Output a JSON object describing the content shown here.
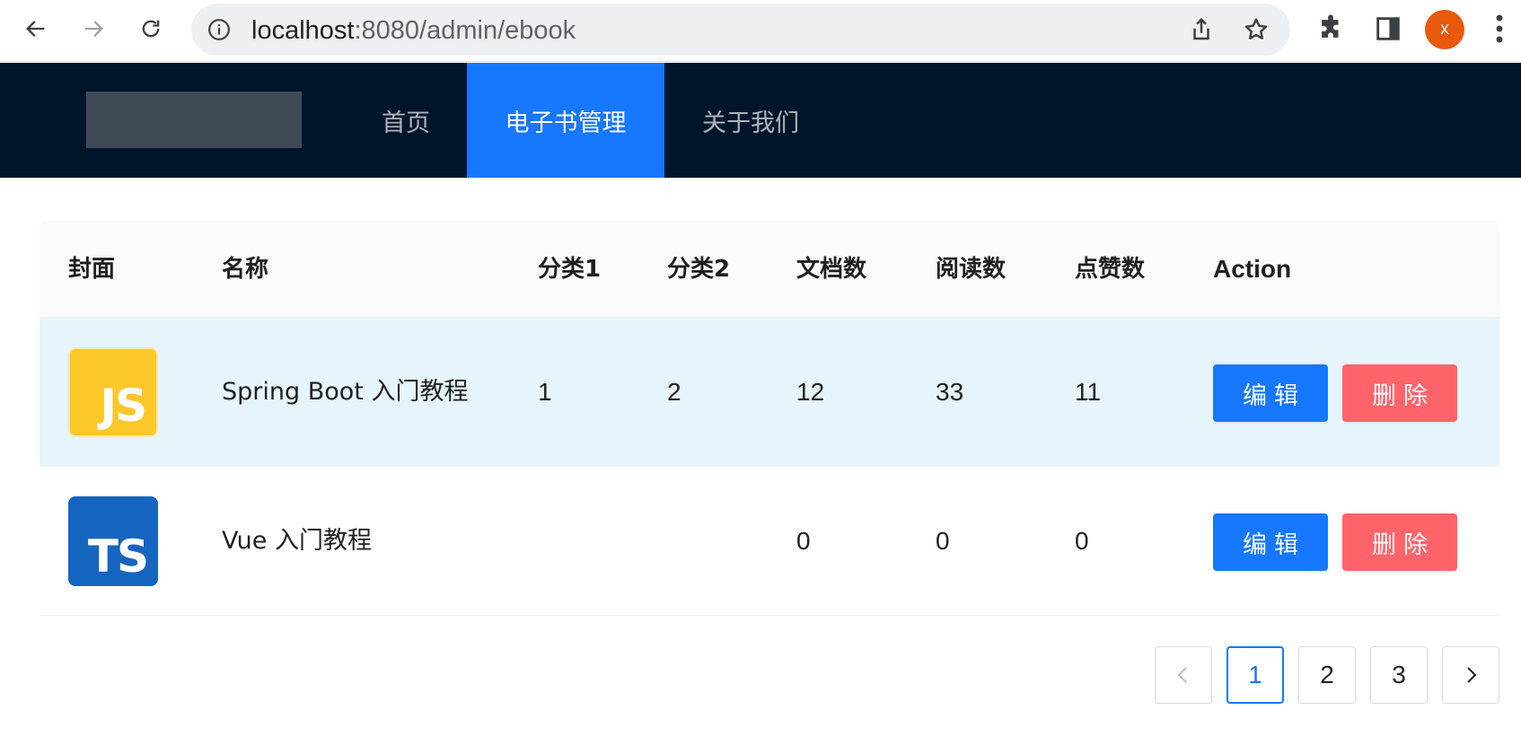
{
  "browser": {
    "url_host": "localhost",
    "url_path": ":8080/admin/ebook",
    "profile_initial": "x"
  },
  "header": {
    "menu": [
      {
        "label": "首页",
        "active": false
      },
      {
        "label": "电子书管理",
        "active": true
      },
      {
        "label": "关于我们",
        "active": false
      }
    ]
  },
  "table": {
    "columns": [
      "封面",
      "名称",
      "分类1",
      "分类2",
      "文档数",
      "阅读数",
      "点赞数",
      "Action"
    ],
    "rows": [
      {
        "cover": "JS",
        "name": "Spring Boot 入门教程",
        "category1": "1",
        "category2": "2",
        "docs": "12",
        "views": "33",
        "likes": "11"
      },
      {
        "cover": "TS",
        "name": "Vue 入门教程",
        "category1": "",
        "category2": "",
        "docs": "0",
        "views": "0",
        "likes": "0"
      }
    ],
    "edit_label": "编辑",
    "delete_label": "删除"
  },
  "pagination": {
    "pages": [
      "1",
      "2",
      "3"
    ],
    "current": "1"
  },
  "colors": {
    "header_bg": "#001529",
    "primary": "#1677ff",
    "danger": "#ff646b",
    "selected_row": "#e6f4fb"
  }
}
